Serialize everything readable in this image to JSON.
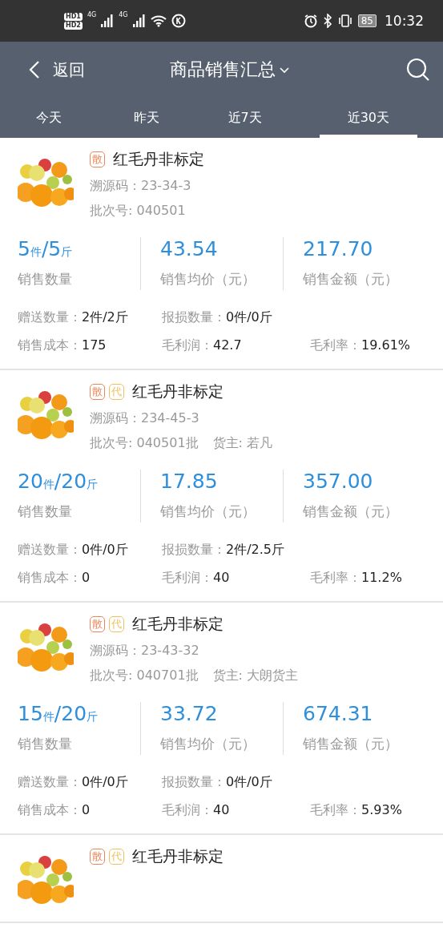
{
  "status_bar": {
    "sims": [
      {
        "label": "HD",
        "slot": "1"
      },
      {
        "label": "HD",
        "slot": "2"
      }
    ],
    "networks": [
      "4G",
      "4G"
    ],
    "battery": "85",
    "time": "10:32"
  },
  "header": {
    "back": "返回",
    "title": "商品销售汇总"
  },
  "tabs": [
    {
      "label": "今天",
      "selected": false
    },
    {
      "label": "昨天",
      "selected": false
    },
    {
      "label": "近7天",
      "selected": false
    },
    {
      "label": "近30天",
      "selected": true
    }
  ],
  "products": [
    {
      "tags": [
        {
          "text": "散",
          "color": "#e8875a"
        }
      ],
      "name": "红毛丹非标定",
      "trace": "溯源码：23-34-3",
      "batch": "批次号: 040501",
      "stats": [
        {
          "value": "5$_{件}$/5$_{斤}$",
          "label": "销售数量"
        },
        {
          "value": "43.54",
          "label": "销售均价（元）"
        },
        {
          "value": "217.70",
          "label": "销售金额（元）"
        }
      ],
      "details": [
        [
          {
            "label": "赠送数量：",
            "value": "2件/2斤"
          },
          {
            "label": "报损数量：",
            "value": "0件/0斤"
          }
        ],
        [
          {
            "label": "销售成本：",
            "value": "175"
          },
          {
            "label": "毛利润：",
            "value": "42.7"
          },
          {
            "label": "毛利率：",
            "value": "19.61%"
          }
        ]
      ]
    },
    {
      "tags": [
        {
          "text": "散",
          "color": "#e8875a"
        },
        {
          "text": "代",
          "color": "#f0c060"
        }
      ],
      "name": "红毛丹非标定",
      "trace": "溯源码：234-45-3",
      "batch": "批次号: 040501批",
      "owner": "货主: 若凡",
      "stats": [
        {
          "value": "20$_{件}$/20$_{斤}$",
          "label": "销售数量"
        },
        {
          "value": "17.85",
          "label": "销售均价（元）"
        },
        {
          "value": "357.00",
          "label": "销售金额（元）"
        }
      ],
      "details": [
        [
          {
            "label": "赠送数量：",
            "value": "0件/0斤"
          },
          {
            "label": "报损数量：",
            "value": "2件/2.5斤"
          }
        ],
        [
          {
            "label": "销售成本：",
            "value": "0"
          },
          {
            "label": "毛利润：",
            "value": "40"
          },
          {
            "label": "毛利率：",
            "value": "11.2%"
          }
        ]
      ]
    },
    {
      "tags": [
        {
          "text": "散",
          "color": "#e8875a"
        },
        {
          "text": "代",
          "color": "#f0c060"
        }
      ],
      "name": "红毛丹非标定",
      "trace": "溯源码：23-43-32",
      "batch": "批次号: 040701批",
      "owner": "货主: 大朗货主",
      "stats": [
        {
          "value": "15$_{件}$/20$_{斤}$",
          "label": "销售数量"
        },
        {
          "value": "33.72",
          "label": "销售均价（元）"
        },
        {
          "value": "674.31",
          "label": "销售金额（元）"
        }
      ],
      "details": [
        [
          {
            "label": "赠送数量：",
            "value": "0件/0斤"
          },
          {
            "label": "报损数量：",
            "value": "0件/0斤"
          }
        ],
        [
          {
            "label": "销售成本：",
            "value": "0"
          },
          {
            "label": "毛利润：",
            "value": "40"
          },
          {
            "label": "毛利率：",
            "value": "5.93%"
          }
        ]
      ]
    },
    {
      "tags": [
        {
          "text": "散",
          "color": "#e8875a"
        },
        {
          "text": "代",
          "color": "#f0c060"
        }
      ],
      "name": "红毛丹非标定"
    }
  ]
}
